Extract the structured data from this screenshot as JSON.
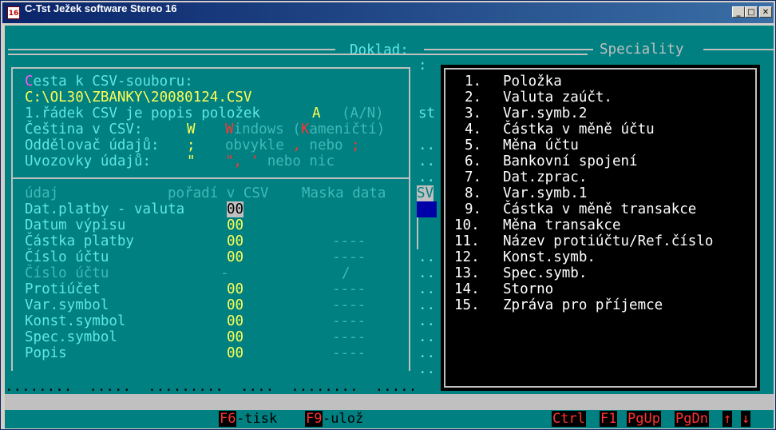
{
  "window": {
    "app_icon": "16",
    "title": "C-Tst Ježek software Stereo 16",
    "minimize_label": "_",
    "maximize_label": "□",
    "close_label": "✕"
  },
  "doklad": {
    "header": "Doklad:"
  },
  "csv_settings": {
    "path_label_first": "C",
    "path_label_rest": "esta k CSV-souboru:",
    "path_value": "C:\\OL30\\ZBANKY\\20080124.CSV",
    "first_row_label": "1.řádek CSV je popis položek",
    "first_row_value": "A",
    "first_row_hint": "(A/N)",
    "encoding_label": "Čeština v CSV:",
    "encoding_value": "W",
    "encoding_opt1_key": "W",
    "encoding_opt1_rest": "indows",
    "encoding_opt2_open": "(",
    "encoding_opt2_key": "K",
    "encoding_opt2_rest": "ameničtí)",
    "separator_label": "Oddělovač údajů:",
    "separator_value": ";",
    "separator_hint": "obvykle",
    "separator_opt1": ",",
    "separator_hint2": "nebo",
    "separator_opt2": ";",
    "quotes_label": "Uvozovky údajů:",
    "quotes_value": "\"",
    "quotes_opt1": "\",",
    "quotes_opt2": "'",
    "quotes_hint": "nebo nic"
  },
  "fields_table": {
    "headers": {
      "field": "údaj",
      "order": "pořadí v CSV",
      "mask": "Maska data"
    },
    "rows": [
      {
        "name": "Dat.platby - valuta",
        "order": "00",
        "mask": "",
        "active": true,
        "disabled": false
      },
      {
        "name": "Datum výpisu",
        "order": "00",
        "mask": "",
        "active": false,
        "disabled": false
      },
      {
        "name": "Částka platby",
        "order": "00",
        "mask": "----",
        "active": false,
        "disabled": false
      },
      {
        "name": "Číslo účtu",
        "order": "00",
        "mask": "----",
        "active": false,
        "disabled": false
      },
      {
        "name": "Číslo účtu",
        "order": "-",
        "mask": "/",
        "active": false,
        "disabled": true
      },
      {
        "name": "Protiúčet",
        "order": "00",
        "mask": "----",
        "active": false,
        "disabled": false
      },
      {
        "name": "Var.symbol",
        "order": "00",
        "mask": "----",
        "active": false,
        "disabled": false
      },
      {
        "name": "Konst.symbol",
        "order": "00",
        "mask": "----",
        "active": false,
        "disabled": false
      },
      {
        "name": "Spec.symbol",
        "order": "00",
        "mask": "----",
        "active": false,
        "disabled": false
      },
      {
        "name": "Popis",
        "order": "00",
        "mask": "----",
        "active": false,
        "disabled": false
      }
    ]
  },
  "middle_fragments": {
    "st": "st",
    "sv": "SV",
    "colon": ":"
  },
  "specialities": {
    "title": "Speciality",
    "items": [
      {
        "num": "1.",
        "label": "Položka"
      },
      {
        "num": "2.",
        "label": "Valuta zaúčt."
      },
      {
        "num": "3.",
        "label": "Var.symb.2"
      },
      {
        "num": "4.",
        "label": "Částka v měně účtu"
      },
      {
        "num": "5.",
        "label": "Měna účtu"
      },
      {
        "num": "6.",
        "label": "Bankovní spojení"
      },
      {
        "num": "7.",
        "label": "Dat.zprac."
      },
      {
        "num": "8.",
        "label": "Var.symb.1"
      },
      {
        "num": "9.",
        "label": "Částka v měně transakce"
      },
      {
        "num": "10.",
        "label": "Měna transakce"
      },
      {
        "num": "11.",
        "label": "Název protiúčtu/Ref.číslo"
      },
      {
        "num": "12.",
        "label": "Konst.symb."
      },
      {
        "num": "13.",
        "label": "Spec.symb."
      },
      {
        "num": "14.",
        "label": "Storno"
      },
      {
        "num": "15.",
        "label": "Zpráva pro příjemce"
      }
    ]
  },
  "statusbar": {
    "dots": "........  .....  .........  ....  ........  .....",
    "f6_key": "F6",
    "f6_label": "-tisk",
    "f9_key": "F9",
    "f9_label": "-ulož",
    "ctrl_key": "Ctrl",
    "f1_key": "F1",
    "pgup_key": "PgUp",
    "pgdn_key": "PgDn",
    "up_key": "↑",
    "down_key": "↓"
  }
}
